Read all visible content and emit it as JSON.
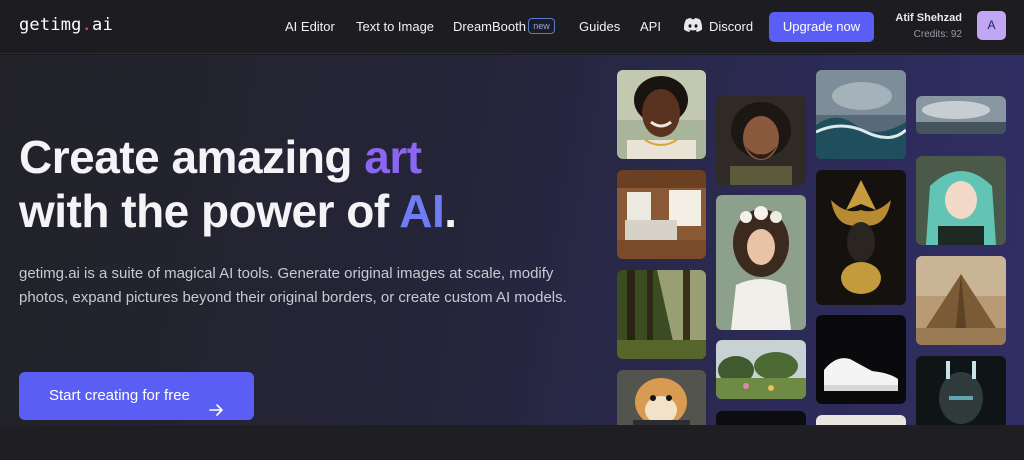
{
  "logo": {
    "pre": "getimg",
    "dot": ".",
    "post": "ai"
  },
  "nav": {
    "ai_editor": "AI Editor",
    "text_to_image": "Text to Image",
    "dreambooth": "DreamBooth",
    "dreambooth_badge": "new",
    "guides": "Guides",
    "api": "API",
    "discord": "Discord",
    "discord_icon": "discord-icon"
  },
  "upgrade_label": "Upgrade now",
  "user": {
    "name": "Atif Shehzad",
    "credits": "Credits: 92",
    "avatar_letter": "A"
  },
  "hero": {
    "line1": "Create amazing ",
    "line1_accent": "art",
    "line2": "with the power of ",
    "line2_accent": "AI",
    "line2_end": ".",
    "description": "getimg.ai is a suite of magical AI tools. Generate original images at scale, modify photos, expand pictures beyond their original borders, or create custom AI models.",
    "cta_label": "Start creating for free",
    "cta_icon": "arrow-right-icon"
  },
  "colors": {
    "accent": "#5b5ef5",
    "art_purple": "#8b66f0",
    "ai_blue": "#6f7cf5",
    "logo_dot": "#f0476a"
  },
  "gallery": [
    "portrait-man-smiling",
    "bedroom-interior",
    "sunlit-forest",
    "hamster-in-suit",
    "bearded-warrior-portrait",
    "woman-with-flower-crown",
    "garden-landscape",
    "dark-tile",
    "stormy-ocean-waves",
    "golden-ornate-mask",
    "white-sneaker",
    "light-tile",
    "cloudy-seascape",
    "anime-girl-teal-hair",
    "stepped-pyramid",
    "cyborg-face"
  ]
}
